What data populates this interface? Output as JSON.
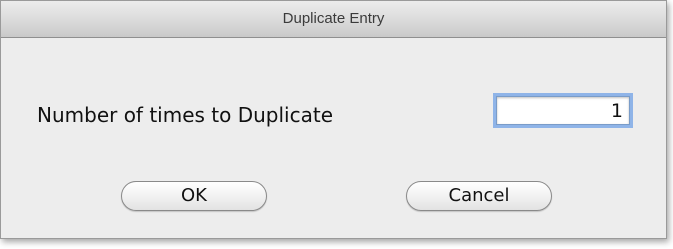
{
  "window": {
    "title": "Duplicate Entry"
  },
  "form": {
    "label": "Number of times to Duplicate",
    "value": "1"
  },
  "buttons": {
    "ok_label": "OK",
    "cancel_label": "Cancel"
  },
  "colors": {
    "focus_ring": "#8fb4e8",
    "window_bg": "#ececec"
  }
}
